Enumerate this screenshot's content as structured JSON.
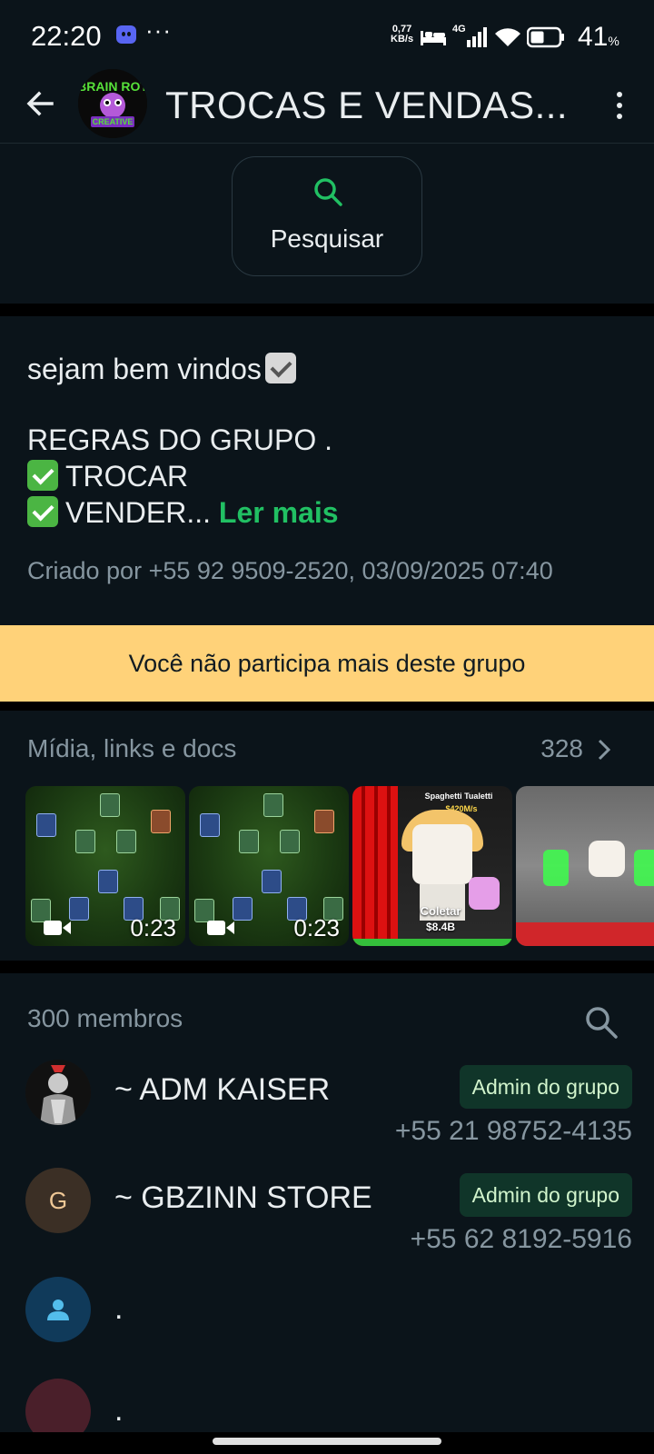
{
  "status_bar": {
    "time": "22:20",
    "dots": "···",
    "speed_value": "0,77",
    "speed_unit": "KB/s",
    "network": "4G",
    "battery": "41",
    "battery_unit": "%"
  },
  "header": {
    "title": "TROCAS E VENDAS...",
    "back_icon": "arrow-left-icon",
    "menu_icon": "more-vert-icon"
  },
  "search": {
    "label": "Pesquisar",
    "icon": "search-icon",
    "accent": "#21c063"
  },
  "description": {
    "line1": "sejam bem vindos",
    "line2": "REGRAS DO GRUPO .",
    "line3": "TROCAR",
    "line4": "VENDER...",
    "read_more": "Ler mais",
    "created": "Criado por +55 92 9509-2520, 03/09/2025 07:40"
  },
  "banner": {
    "text": "Você não participa mais deste grupo",
    "color": "#ffd279"
  },
  "media": {
    "title": "Mídia, links e docs",
    "count": "328",
    "items": [
      {
        "kind": "video",
        "duration": "0:23"
      },
      {
        "kind": "video",
        "duration": "0:23"
      },
      {
        "kind": "image",
        "sign_title": "Spaghetti Tualetti",
        "sign_price": "$420M/s",
        "collect_label": "Coletar",
        "collect_value": "$8.4B"
      },
      {
        "kind": "image"
      }
    ]
  },
  "members": {
    "title": "300 membros",
    "list": [
      {
        "name": "~ ADM KAISER",
        "badge": "Admin do grupo",
        "phone": "+55 21 98752-4135"
      },
      {
        "name": "~ GBZINN STORE",
        "badge": "Admin do grupo",
        "phone": "+55 62 8192-5916",
        "initial": "G"
      },
      {
        "name": "."
      },
      {
        "name": "."
      }
    ]
  }
}
